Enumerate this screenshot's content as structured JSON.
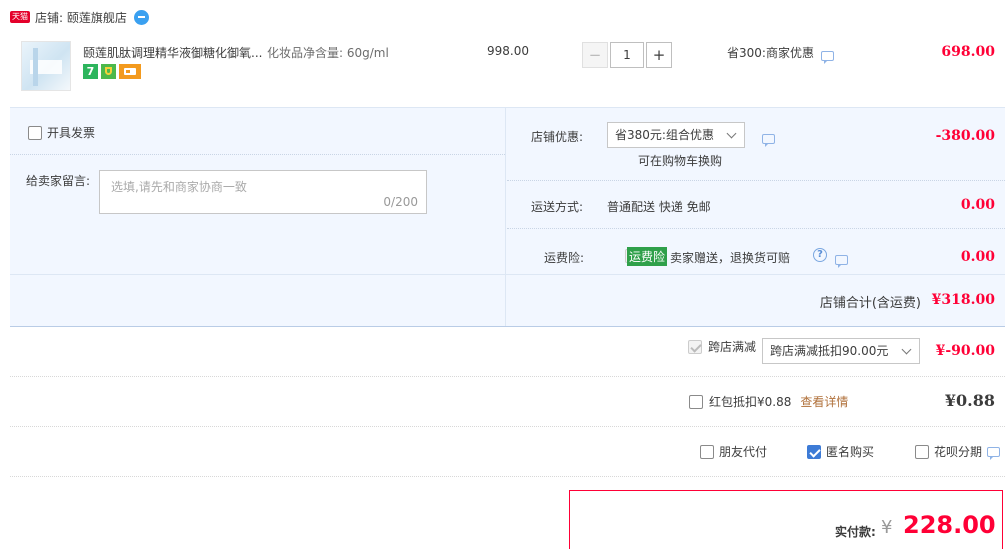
{
  "shop": {
    "badge": "天猫",
    "label": "店铺: 颐莲旗舰店"
  },
  "item": {
    "title": "颐莲肌肽调理精华液御糖化御氧...",
    "spec": "化妆品净含量: 60g/ml",
    "price": "998.00",
    "quantity": "1",
    "minus": "−",
    "plus": "+",
    "discount_note": "省300:商家优惠",
    "subtotal": "698.00",
    "badge_7": "7"
  },
  "invoice": {
    "label": "开具发票"
  },
  "message": {
    "label": "给卖家留言:",
    "placeholder": "选填,请先和商家协商一致",
    "counter": "0/200"
  },
  "shop_discount": {
    "label": "店铺优惠:",
    "selected": "省380元:组合优惠",
    "hint": "可在购物车换购",
    "amount": "-380.00"
  },
  "shipping": {
    "label": "运送方式:",
    "value": "普通配送 快递 免邮",
    "amount": "0.00"
  },
  "insurance": {
    "label": "运费险:",
    "tag": "运费险",
    "desc": "卖家赠送，退换货可赔",
    "amount": "0.00"
  },
  "shop_total": {
    "label": "店铺合计(含运费)",
    "amount": "¥318.00"
  },
  "cross_store": {
    "label": "跨店满减",
    "selected": "跨店满减抵扣90.00元",
    "amount": "¥-90.00"
  },
  "red_packet": {
    "label": "红包抵扣¥0.88",
    "link": "查看详情",
    "amount": "¥0.88"
  },
  "options": {
    "friend_pay": "朋友代付",
    "anonymous": "匿名购买",
    "huabei": "花呗分期"
  },
  "final": {
    "label": "实付款:",
    "currency": "¥",
    "amount": "228.00"
  },
  "colors": {
    "price_red": "#ff0036",
    "panel_bg": "#f2f7ff",
    "check_blue": "#3d7bd6",
    "insurance_green": "#2fa04a"
  }
}
